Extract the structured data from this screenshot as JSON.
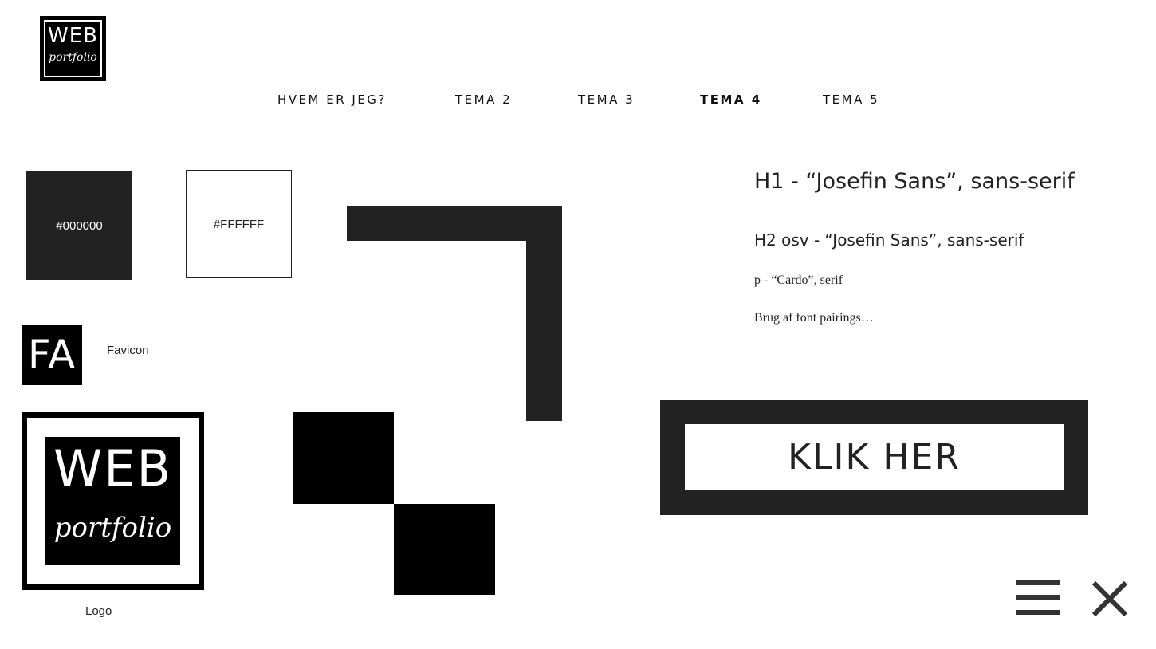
{
  "header": {
    "logo": {
      "word": "WEB",
      "script": "portfolio"
    },
    "nav": [
      {
        "label": "HVEM ER JEG?",
        "active": false
      },
      {
        "label": "TEMA 2",
        "active": false
      },
      {
        "label": "TEMA 3",
        "active": false
      },
      {
        "label": "TEMA 4",
        "active": true
      },
      {
        "label": "TEMA 5",
        "active": false
      }
    ]
  },
  "colors": {
    "black": "#000000",
    "white": "#FFFFFF"
  },
  "favicon": {
    "text": "FA",
    "caption": "Favicon"
  },
  "logo_large": {
    "word": "WEB",
    "script": "portfolio",
    "caption": "Logo"
  },
  "typography": {
    "h1": "H1 - “Josefin Sans”, sans-serif",
    "h2": "H2 osv - “Josefin Sans”, sans-serif",
    "p": "p - “Cardo”, serif",
    "note": "Brug af font pairings…"
  },
  "cta": {
    "label": "KLIK HER"
  },
  "icons": [
    "hamburger-menu-icon",
    "close-icon"
  ]
}
